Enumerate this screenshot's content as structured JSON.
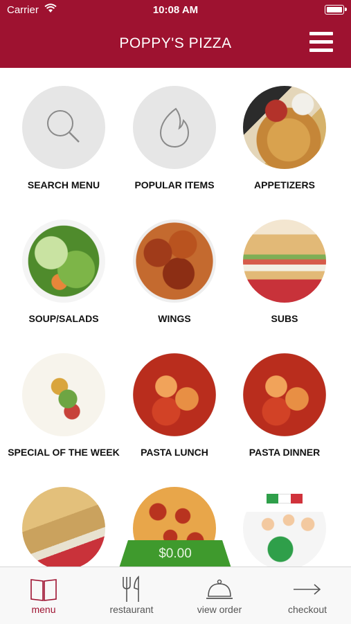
{
  "status_bar": {
    "carrier": "Carrier",
    "time": "10:08 AM"
  },
  "header": {
    "title": "POPPY'S PIZZA"
  },
  "menu": {
    "categories": [
      {
        "label": "SEARCH MENU"
      },
      {
        "label": "POPULAR ITEMS"
      },
      {
        "label": "APPETIZERS"
      },
      {
        "label": "SOUP/SALADS"
      },
      {
        "label": "WINGS"
      },
      {
        "label": "SUBS"
      },
      {
        "label": "SPECIAL OF THE WEEK"
      },
      {
        "label": "PASTA LUNCH"
      },
      {
        "label": "PASTA DINNER"
      }
    ]
  },
  "cart": {
    "total": "$0.00"
  },
  "tabbar": {
    "items": [
      {
        "label": "menu"
      },
      {
        "label": "restaurant"
      },
      {
        "label": "view order"
      },
      {
        "label": "checkout"
      }
    ]
  },
  "colors": {
    "brand": "#9e1230",
    "cart": "#3f9a2d"
  }
}
